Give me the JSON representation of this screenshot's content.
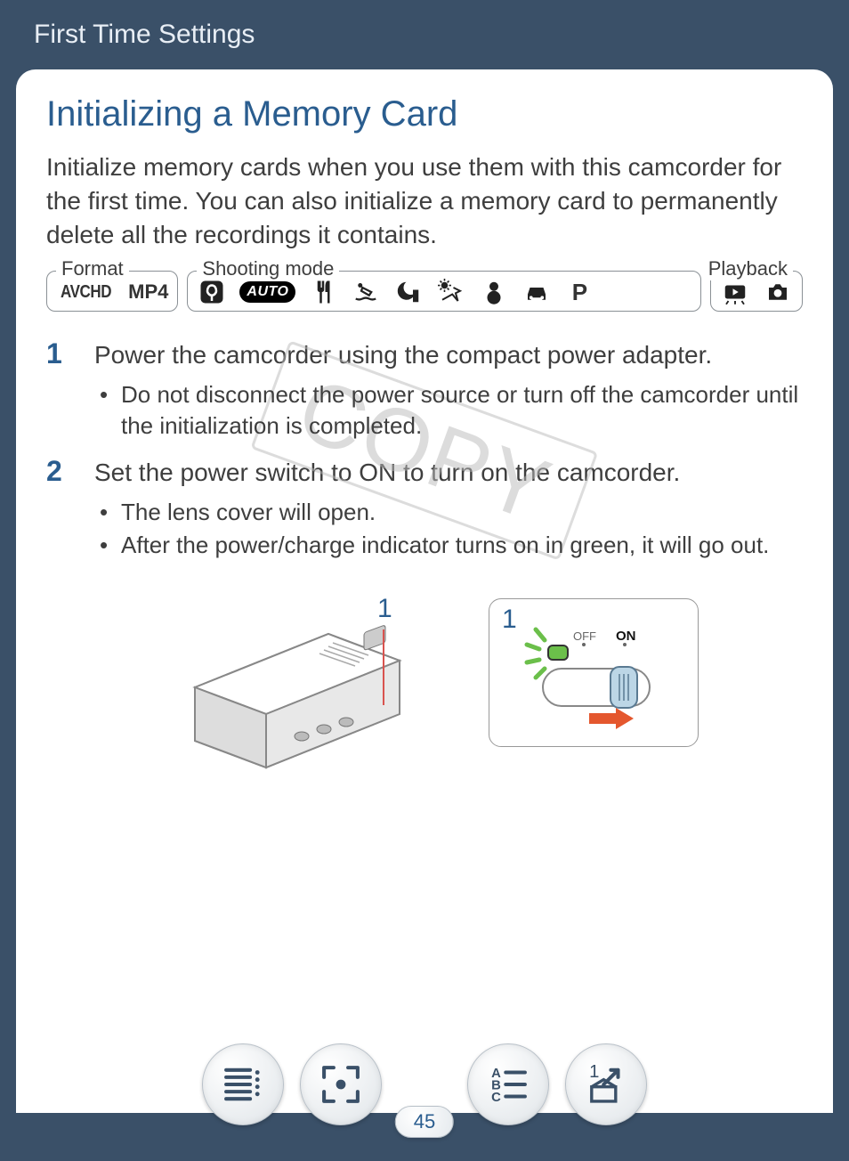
{
  "header": {
    "breadcrumb": "First Time Settings"
  },
  "title": "Initializing a Memory Card",
  "intro": "Initialize memory cards when you use them with this camcorder for the first time. You can also initialize a memory card to permanently delete all the recordings it contains.",
  "mode_bar": {
    "format": {
      "label": "Format",
      "avchd": "AVCHD",
      "mp4": "MP4"
    },
    "shooting": {
      "label": "Shooting mode",
      "auto_text": "AUTO",
      "p_text": "P",
      "icons": [
        "macro-icon",
        "auto-icon",
        "cutlery-icon",
        "diver-icon",
        "night-icon",
        "beach-icon",
        "snowman-icon",
        "car-icon",
        "p-icon"
      ]
    },
    "playback": {
      "label": "Playback",
      "icons": [
        "film-play-icon",
        "photo-play-icon"
      ]
    }
  },
  "steps": [
    {
      "num": "1",
      "text": "Power the camcorder using the compact power adapter.",
      "bullets": [
        "Do not disconnect the power source or turn off the camcorder until the initialization is completed."
      ]
    },
    {
      "num": "2",
      "text": "Set the power switch to ON to turn on the camcorder.",
      "bullets": [
        "The lens cover will open.",
        "After the power/charge indicator turns on in green, it will go out."
      ]
    }
  ],
  "illustrations": {
    "camcorder_callout": "1",
    "switch_callout": "1",
    "switch_off": "OFF",
    "switch_on": "ON"
  },
  "watermark": "COPY",
  "page_number": "45",
  "nav": {
    "buttons": [
      "toc-icon",
      "expand-icon",
      "index-icon",
      "return-icon"
    ]
  }
}
